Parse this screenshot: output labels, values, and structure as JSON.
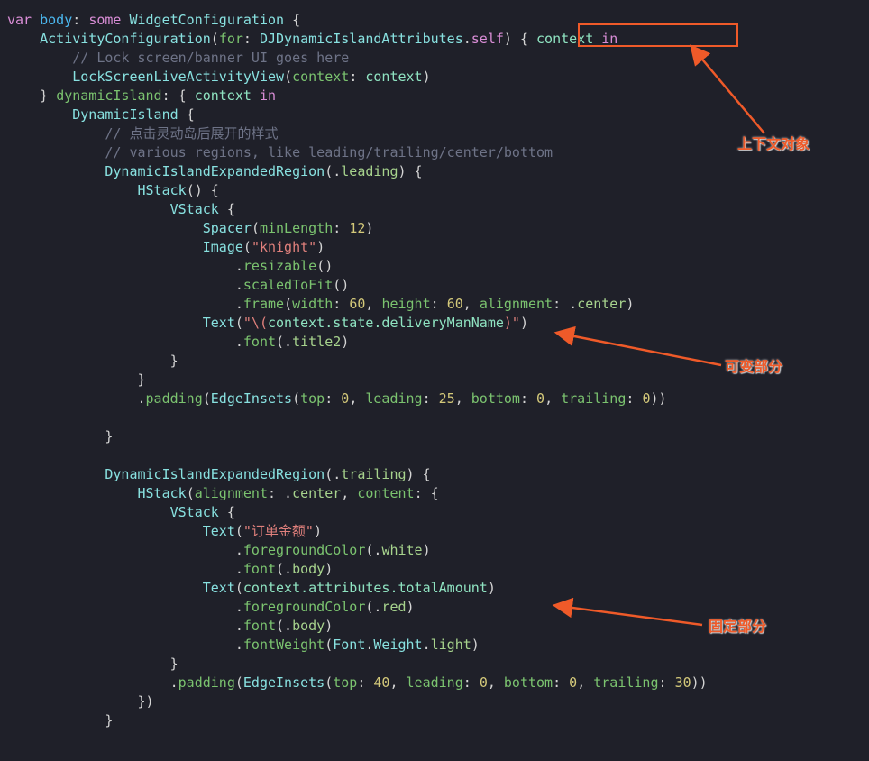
{
  "code": {
    "l1": {
      "var": "var",
      "body": "body",
      "some": "some",
      "type": "WidgetConfiguration"
    },
    "l2": {
      "type": "ActivityConfiguration",
      "for": "for",
      "attrType": "DJDynamicIslandAttributes",
      "self": "self",
      "ctx": "context",
      "in": "in"
    },
    "l3": {
      "cmt": "// Lock screen/banner UI goes here"
    },
    "l4": {
      "fn": "LockScreenLiveActivityView",
      "lbl": "context",
      "arg": "context"
    },
    "l5": {
      "fn": "dynamicIsland",
      "ctx": "context",
      "in": "in"
    },
    "l6": {
      "type": "DynamicIsland"
    },
    "l7": {
      "cmt": "// 点击灵动岛后展开的样式"
    },
    "l8": {
      "cmt": "// various regions, like leading/trailing/center/bottom"
    },
    "l9": {
      "type": "DynamicIslandExpandedRegion",
      "arg": "leading"
    },
    "l10": {
      "fn": "HStack"
    },
    "l11": {
      "fn": "VStack"
    },
    "l12": {
      "fn": "Spacer",
      "lbl": "minLength",
      "val": "12"
    },
    "l13": {
      "fn": "Image",
      "str": "\"knight\""
    },
    "l14": {
      "fn": "resizable"
    },
    "l15": {
      "fn": "scaledToFit"
    },
    "l16": {
      "fn": "frame",
      "w": "width",
      "wv": "60",
      "h": "height",
      "hv": "60",
      "a": "alignment",
      "av": "center"
    },
    "l17": {
      "fn": "Text",
      "str1": "\"\\(",
      "path": "context.state.deliveryManName",
      "str2": ")\""
    },
    "l18": {
      "fn": "font",
      "arg": "title2"
    },
    "l19": {
      "fn": "padding",
      "ei": "EdgeInsets",
      "top": "top",
      "tv": "0",
      "lead": "leading",
      "lv": "25",
      "bot": "bottom",
      "bv": "0",
      "tr": "trailing",
      "trv": "0"
    },
    "l20": {
      "type": "DynamicIslandExpandedRegion",
      "arg": "trailing"
    },
    "l21": {
      "fn": "HStack",
      "al": "alignment",
      "alv": "center",
      "ct": "content"
    },
    "l22": {
      "fn": "VStack"
    },
    "l23": {
      "fn": "Text",
      "str": "\"订单金额\""
    },
    "l24": {
      "fn": "foregroundColor",
      "arg": "white"
    },
    "l25": {
      "fn": "font",
      "arg": "body"
    },
    "l26": {
      "fn": "Text",
      "path": "context.attributes.totalAmount"
    },
    "l27": {
      "fn": "foregroundColor",
      "arg": "red"
    },
    "l28": {
      "fn": "font",
      "arg": "body"
    },
    "l29": {
      "fn": "fontWeight",
      "t": "Font",
      "w": "Weight",
      "v": "light"
    },
    "l30": {
      "fn": "padding",
      "ei": "EdgeInsets",
      "top": "top",
      "tv": "40",
      "lead": "leading",
      "lv": "0",
      "bot": "bottom",
      "bv": "0",
      "tr": "trailing",
      "trv": "30"
    }
  },
  "annotations": {
    "a1": "上下文对象",
    "a2": "可变部分",
    "a3": "固定部分"
  }
}
